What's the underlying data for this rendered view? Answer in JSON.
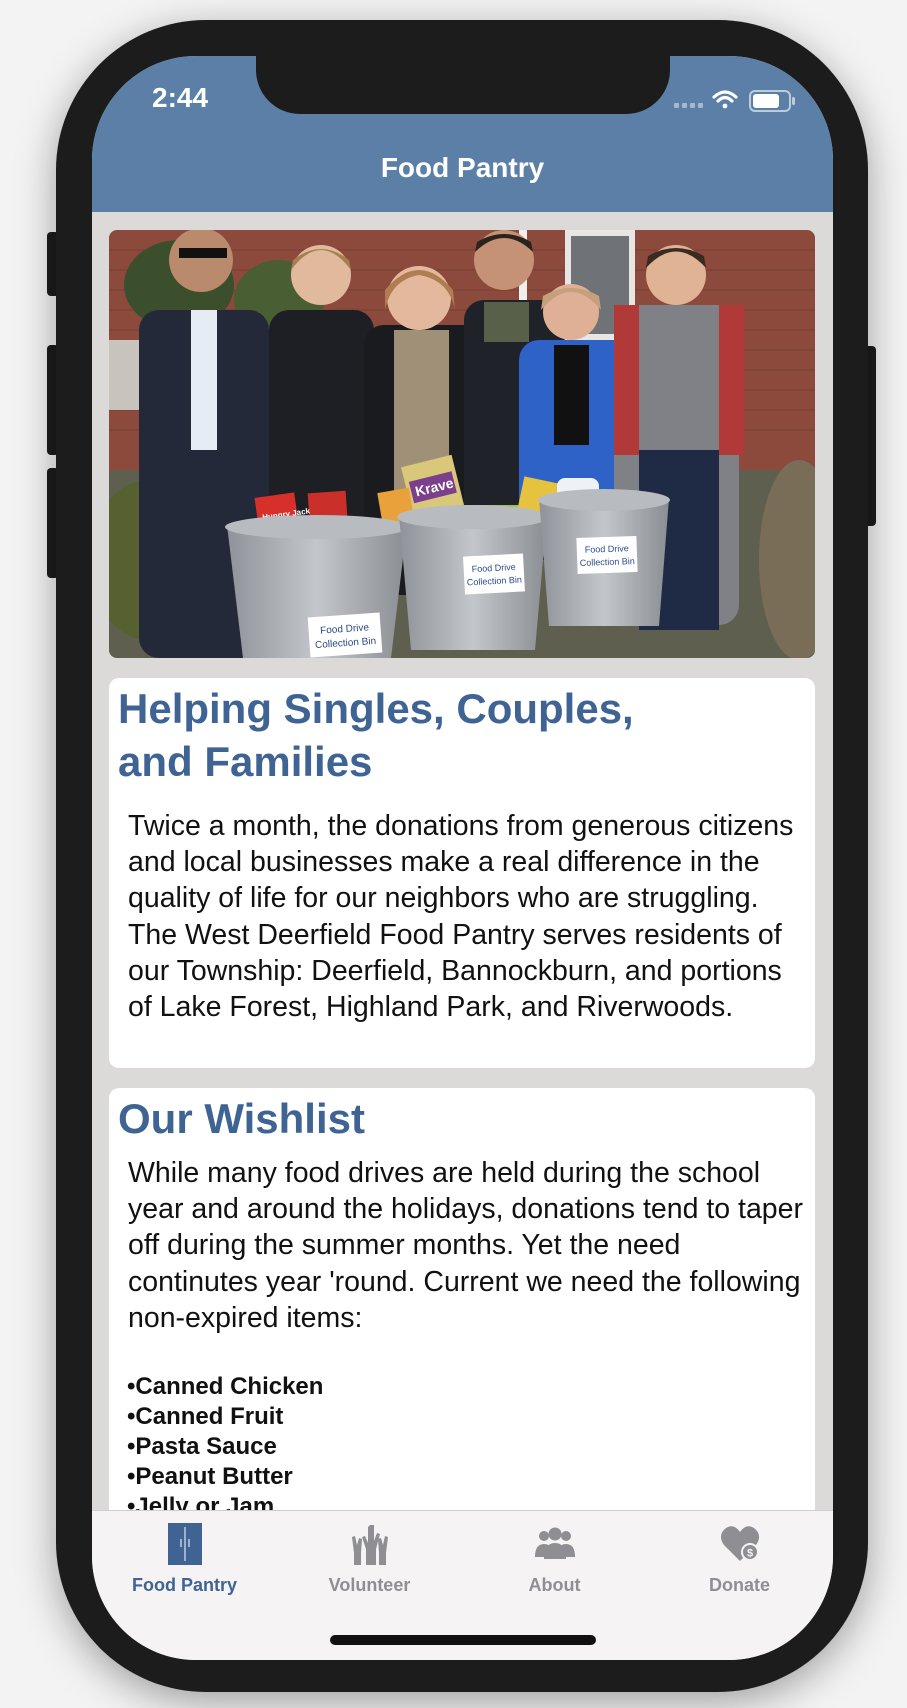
{
  "status": {
    "time": "2:44"
  },
  "nav": {
    "title": "Food Pantry"
  },
  "hero": {
    "bin_label_line1": "Food Drive",
    "bin_label_line2": "Collection Bin",
    "cereal_brand": "Krave",
    "box_brand": "Hungry Jack"
  },
  "cards": {
    "helping": {
      "title_line1": "Helping Singles, Couples,",
      "title_line2": "and Families",
      "body": "Twice a month, the donations from generous citizens and local businesses make a real difference in the quality of life for our neighbors who are struggling. The West Deerfield Food Pantry serves residents of our Township: Deerfield, Bannockburn, and portions of Lake Forest, Highland Park, and Riverwoods."
    },
    "wishlist": {
      "title": "Our Wishlist",
      "body": "While many food drives are held during the school year and around the holidays, donations tend to taper off during the  summer months. Yet the need continutes year 'round. Current we need the following non-expired items:",
      "items": [
        "•Canned Chicken",
        "•Canned Fruit",
        "•Pasta Sauce",
        "•Peanut Butter",
        "•Jelly or Jam"
      ]
    }
  },
  "tabs": [
    {
      "label": "Food Pantry",
      "icon": "pantry-door-icon",
      "active": true
    },
    {
      "label": "Volunteer",
      "icon": "raised-hands-icon",
      "active": false
    },
    {
      "label": "About",
      "icon": "people-group-icon",
      "active": false
    },
    {
      "label": "Donate",
      "icon": "heart-dollar-icon",
      "active": false
    }
  ],
  "colors": {
    "accent": "#5b7fa6",
    "heading": "#3f6494",
    "tab_active": "#3f6494",
    "tab_inactive": "#8e8e93"
  }
}
